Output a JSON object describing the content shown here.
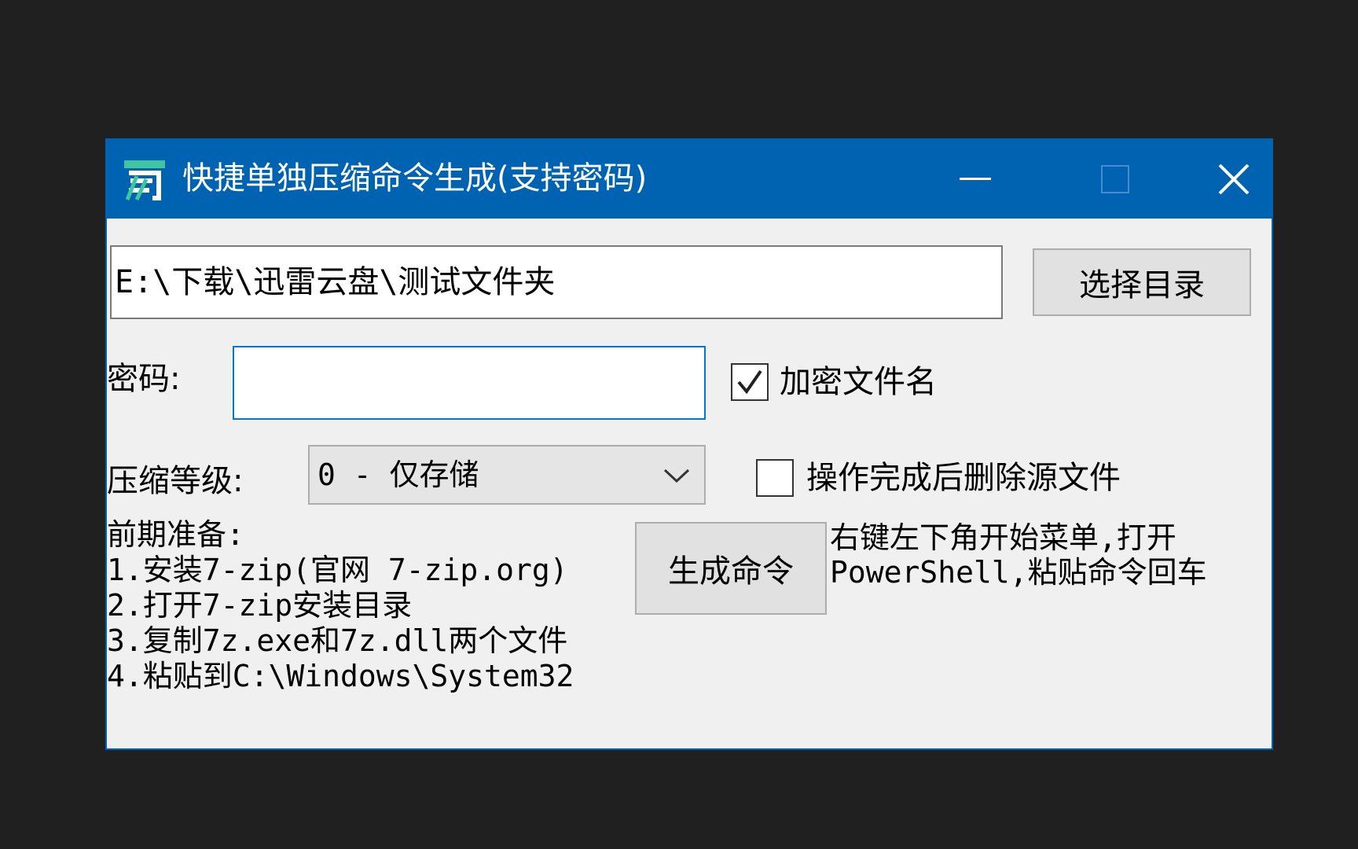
{
  "window": {
    "title": "快捷单独压缩命令生成(支持密码)",
    "icon": "yi-app-icon",
    "accent": "#0063b1"
  },
  "path": {
    "value": "E:\\下载\\迅雷云盘\\测试文件夹",
    "browse_label": "选择目录"
  },
  "password": {
    "label": "密码:",
    "value": "",
    "encrypt_names_label": "加密文件名",
    "encrypt_names_checked": true
  },
  "compression": {
    "label": "压缩等级:",
    "selected": "0 - 仅存储",
    "delete_source_label": "操作完成后删除源文件",
    "delete_source_checked": false
  },
  "prep": {
    "title": "前期准备:",
    "steps": [
      "1.安装7-zip(官网 7-zip.org)",
      "2.打开7-zip安装目录",
      "3.复制7z.exe和7z.dll两个文件",
      "4.粘贴到C:\\Windows\\System32"
    ]
  },
  "generate_label": "生成命令",
  "hint": {
    "line1": "右键左下角开始菜单,打开",
    "line2": "PowerShell,粘贴命令回车"
  }
}
